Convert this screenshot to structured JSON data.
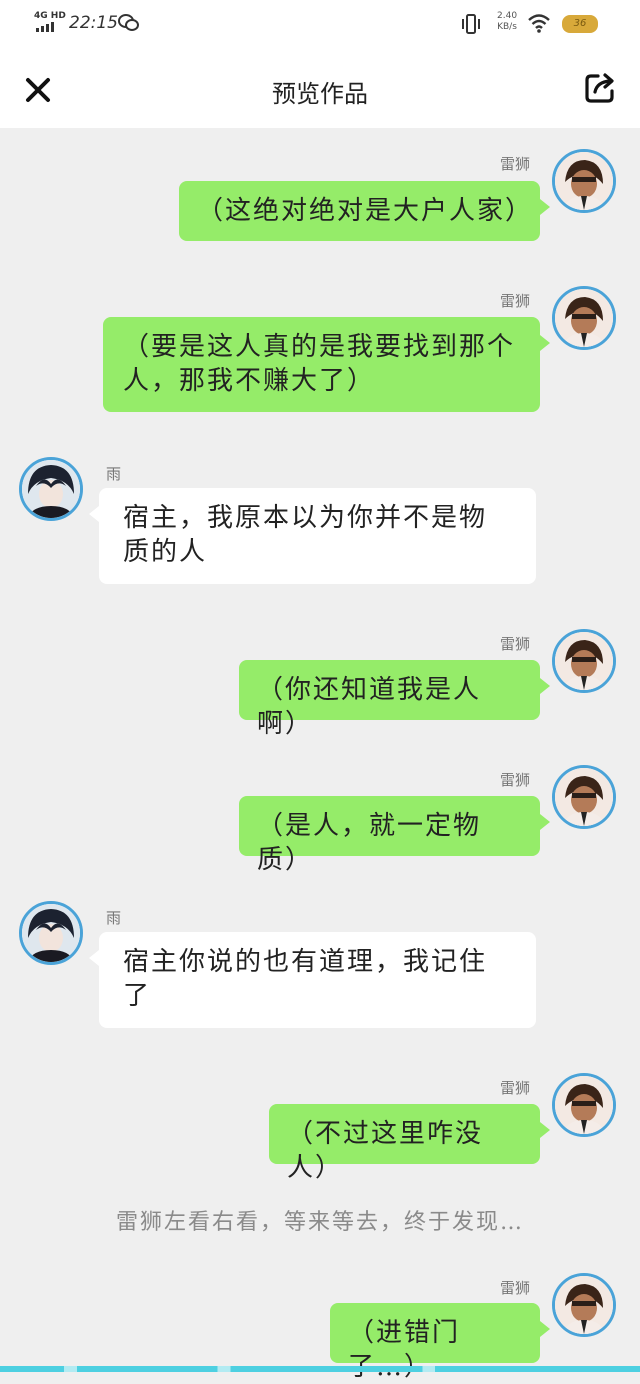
{
  "status_bar": {
    "network": "4G HD",
    "time": "22:15",
    "speed_value": "2.40",
    "speed_unit": "KB/s",
    "battery": "36"
  },
  "header": {
    "title": "预览作品",
    "close_icon": "close-icon",
    "share_icon": "share-icon"
  },
  "messages": [
    {
      "sender": "雷狮",
      "side": "right",
      "text": "（这绝对绝对是大户人家）"
    },
    {
      "sender": "雷狮",
      "side": "right",
      "text": "（要是这人真的是我要找到那个人，那我不赚大了）"
    },
    {
      "sender": "雨",
      "side": "left",
      "text": "宿主，我原本以为你并不是物质的人"
    },
    {
      "sender": "雷狮",
      "side": "right",
      "text": "（你还知道我是人啊）"
    },
    {
      "sender": "雷狮",
      "side": "right",
      "text": "（是人，就一定物质）"
    },
    {
      "sender": "雨",
      "side": "left",
      "text": "宿主你说的也有道理，我记住了"
    },
    {
      "sender": "雷狮",
      "side": "right",
      "text": "（不过这里咋没人）"
    },
    {
      "narration": "雷狮左看右看，等来等去，终于发现…"
    },
    {
      "sender": "雷狮",
      "side": "right",
      "text": "（进错门了…）"
    }
  ],
  "colors": {
    "my_bubble": "#95ec69",
    "other_bubble": "#ffffff",
    "background": "#efefef",
    "avatar_ring": "#4aa3d8"
  }
}
